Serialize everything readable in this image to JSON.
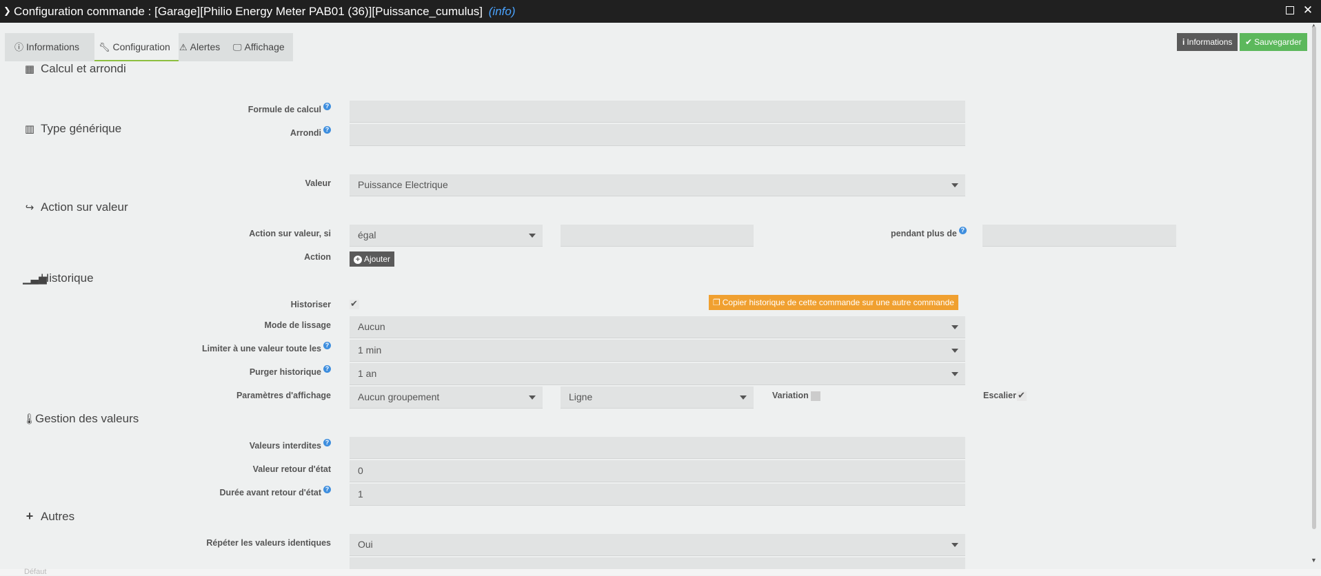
{
  "window": {
    "title": "Configuration commande : [Garage][Philio Energy Meter PAB01 (36)][Puissance_cumulus]",
    "title_suffix": "(info)"
  },
  "tabs": [
    {
      "label": "Informations",
      "icon": "info-circle-icon"
    },
    {
      "label": "Configuration",
      "icon": "wrench-icon"
    },
    {
      "label": "Alertes",
      "icon": "warning-icon"
    },
    {
      "label": "Affichage",
      "icon": "monitor-icon"
    }
  ],
  "top_buttons": {
    "info": "Informations",
    "save": "Sauvegarder"
  },
  "sections": {
    "calcul": "Calcul et arrondi",
    "type": "Type générique",
    "action": "Action sur valeur",
    "historique": "Historique",
    "gestion": "Gestion des valeurs",
    "autres": "Autres"
  },
  "fields": {
    "formule_label": "Formule de calcul",
    "formule_value": "",
    "arrondi_label": "Arrondi",
    "arrondi_value": "",
    "valeur_label": "Valeur",
    "valeur_value": "Puissance Electrique",
    "action_si_label": "Action sur valeur, si",
    "action_si_op": "égal",
    "action_si_value": "",
    "pendant_label": "pendant plus de",
    "pendant_value": "",
    "action_label": "Action",
    "ajouter_label": "Ajouter",
    "historiser_label": "Historiser",
    "historiser_checked": true,
    "copy_history_label": "Copier historique de cette commande sur une autre commande",
    "lissage_label": "Mode de lissage",
    "lissage_value": "Aucun",
    "limiter_label": "Limiter à une valeur toute les",
    "limiter_value": "1 min",
    "purger_label": "Purger historique",
    "purger_value": "1 an",
    "param_label": "Paramètres d'affichage",
    "groupement_value": "Aucun groupement",
    "style_value": "Ligne",
    "variation_label": "Variation",
    "variation_checked": false,
    "escalier_label": "Escalier",
    "escalier_checked": true,
    "interdites_label": "Valeurs interdites",
    "interdites_value": "",
    "retour_label": "Valeur retour d'état",
    "retour_value": "0",
    "duree_label": "Durée avant retour d'état",
    "duree_value": "1",
    "repeter_label": "Répéter les valeurs identiques",
    "repeter_value": "Oui"
  },
  "background": {
    "ghost_text": "Défaut"
  },
  "colors": {
    "accent_green": "#5cb85c",
    "orange": "#f0a030",
    "title_bg": "#202020",
    "help_blue": "#3e8ede"
  }
}
